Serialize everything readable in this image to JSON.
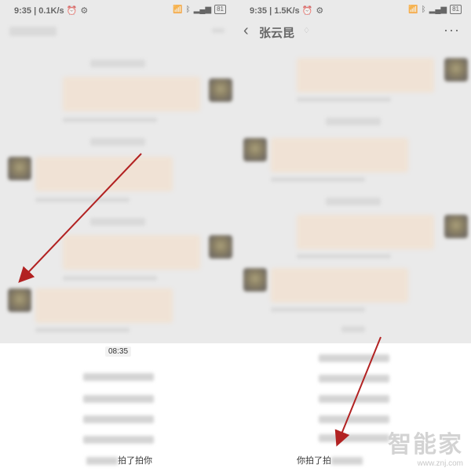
{
  "left": {
    "status": {
      "time": "9:35",
      "speed": "0.1K/s",
      "battery": "81"
    },
    "timestamp": "08:35",
    "pat_text": "拍了拍你"
  },
  "right": {
    "status": {
      "time": "9:35",
      "speed": "1.5K/s",
      "battery": "81"
    },
    "contact_name": "张云昆",
    "pat_text": "你拍了拍"
  },
  "icons": {
    "alarm": "alarm-icon",
    "gear": "gear-icon",
    "wifi": "wifi-icon",
    "bluetooth": "bluetooth-icon",
    "signal": "signal-icon",
    "back": "back-chevron-icon",
    "more": "more-icon",
    "mute": "mute-icon"
  },
  "watermark": {
    "brand": "智能家",
    "url": "www.znj.com"
  },
  "colors": {
    "arrow": "#b22222",
    "bubble": "#f6e1cc",
    "background": "#ededed"
  }
}
